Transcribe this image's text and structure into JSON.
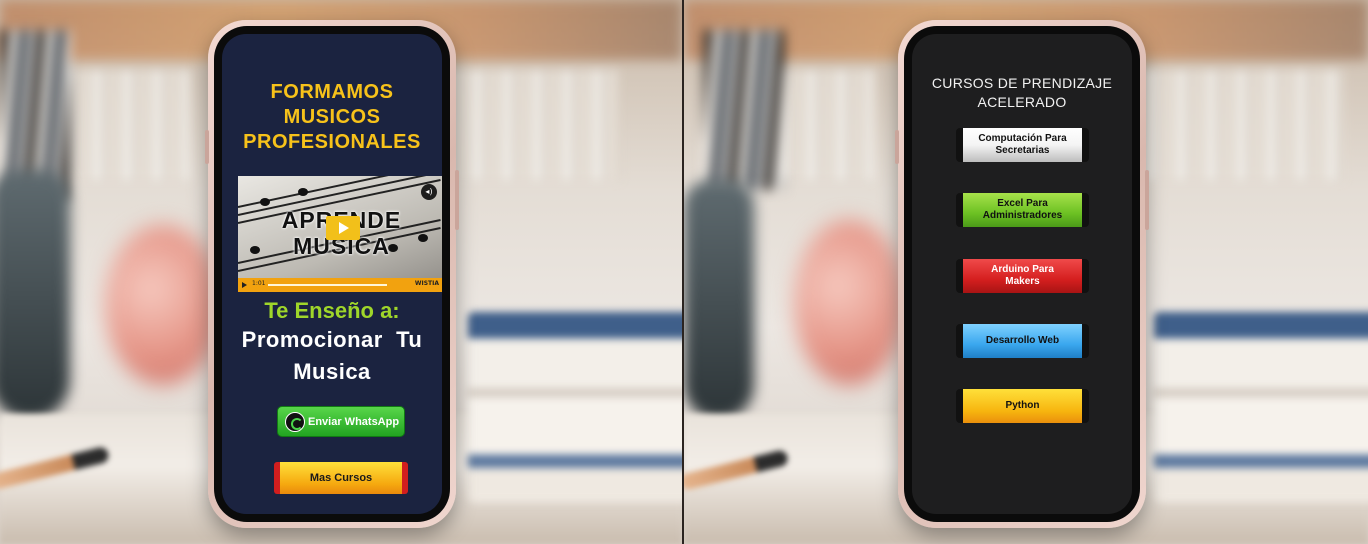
{
  "left_phone": {
    "headline": [
      "FORMAMOS",
      "MUSICOS",
      "PROFESIONALES"
    ],
    "video": {
      "title_line1": "APRENDE",
      "title_line2": "MUSICA",
      "time": "1:01",
      "brand": "WISTIA"
    },
    "teach_line": "Te Enseño a:",
    "promo_lines": [
      "Promocionar  Tu",
      "Musica"
    ],
    "whatsapp_button": "Enviar WhatsApp",
    "more_courses_button": "Mas Cursos"
  },
  "right_phone": {
    "title_lines": [
      "CURSOS DE PRENDIZAJE",
      "ACELERADO"
    ],
    "courses": [
      {
        "label_line1": "Computación Para",
        "label_line2": "Secretarias",
        "color": "#ffffff"
      },
      {
        "label_line1": "Excel Para",
        "label_line2": "Administradores",
        "color": "#6cc123"
      },
      {
        "label_line1": "Arduino Para",
        "label_line2": "Makers",
        "color": "#d51f1f"
      },
      {
        "label_line1": "Desarrollo Web",
        "label_line2": "",
        "color": "#3aa7ee"
      },
      {
        "label_line1": "Python",
        "label_line2": "",
        "color": "#f7b50f"
      }
    ]
  },
  "colors": {
    "accent_yellow": "#f7c21a",
    "accent_green": "#9fd62a",
    "left_screen_bg": "#1b2340",
    "right_screen_bg": "#1e1e1f"
  }
}
